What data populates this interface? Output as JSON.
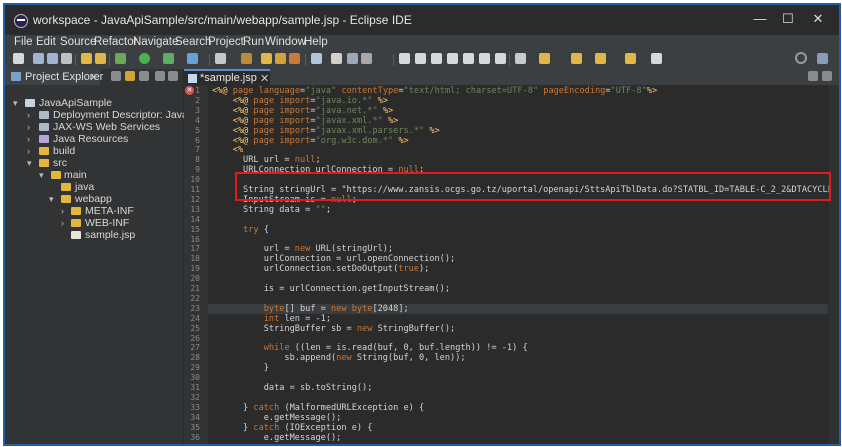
{
  "window": {
    "title": "workspace - JavaApiSample/src/main/webapp/sample.jsp - Eclipse IDE",
    "minimize": "—",
    "maximize": "☐",
    "close": "✕"
  },
  "menu": [
    "File",
    "Edit",
    "Source",
    "Refactor",
    "Navigate",
    "Search",
    "Project",
    "Run",
    "Window",
    "Help"
  ],
  "project_explorer": {
    "tab_label": "Project Explorer",
    "tree": [
      {
        "label": "JavaApiSample",
        "depth": 0,
        "expanded": true,
        "icon": "project-icon"
      },
      {
        "label": "Deployment Descriptor: JavaApiSam",
        "depth": 1,
        "expanded": false,
        "icon": "descriptor-icon"
      },
      {
        "label": "JAX-WS Web Services",
        "depth": 1,
        "expanded": false,
        "icon": "webservice-icon"
      },
      {
        "label": "Java Resources",
        "depth": 1,
        "expanded": false,
        "icon": "library-icon"
      },
      {
        "label": "build",
        "depth": 1,
        "expanded": false,
        "icon": "folder-icon"
      },
      {
        "label": "src",
        "depth": 1,
        "expanded": true,
        "icon": "folder-icon"
      },
      {
        "label": "main",
        "depth": 2,
        "expanded": true,
        "icon": "folder-icon"
      },
      {
        "label": "java",
        "depth": 3,
        "expanded": null,
        "icon": "folder-icon"
      },
      {
        "label": "webapp",
        "depth": 3,
        "expanded": true,
        "icon": "folder-icon"
      },
      {
        "label": "META-INF",
        "depth": 4,
        "expanded": false,
        "icon": "folder-icon"
      },
      {
        "label": "WEB-INF",
        "depth": 4,
        "expanded": false,
        "icon": "folder-icon"
      },
      {
        "label": "sample.jsp",
        "depth": 4,
        "expanded": null,
        "icon": "jsp-file-icon"
      }
    ]
  },
  "editor": {
    "tab_label": "*sample.jsp",
    "highlighted_line": 23,
    "lines": [
      {
        "n": "1",
        "text": "<%@ page language=\"java\" contentType=\"text/html; charset=UTF-8\" pageEncoding=\"UTF-8\"%>"
      },
      {
        "n": "2",
        "text": "    <%@ page import=\"java.io.*\" %>"
      },
      {
        "n": "3",
        "text": "    <%@ page import=\"java.net.*\" %>"
      },
      {
        "n": "4",
        "text": "    <%@ page import=\"javax.xml.*\" %>"
      },
      {
        "n": "5",
        "text": "    <%@ page import=\"javax.xml.parsers.*\" %>"
      },
      {
        "n": "6",
        "text": "    <%@ page import=\"org.w3c.dom.*\" %>"
      },
      {
        "n": "7",
        "text": "    <%"
      },
      {
        "n": "8",
        "text": "      URL url = null;"
      },
      {
        "n": "9",
        "text": "      URLConnection urlConnection = null;"
      },
      {
        "n": "10",
        "text": ""
      },
      {
        "n": "11",
        "text": "      String stringUrl = \"https://www.zansis.ocgs.go.tz/uportal/openapi/SttsApiTblData.do?STATBL_ID=TABLE-C_2_2&DTACYCLE_CD=YY&WRTTIM"
      },
      {
        "n": "12",
        "text": "      InputStream is = null;"
      },
      {
        "n": "13",
        "text": "      String data = \"\";"
      },
      {
        "n": "14",
        "text": ""
      },
      {
        "n": "15",
        "text": "      try {"
      },
      {
        "n": "16",
        "text": ""
      },
      {
        "n": "17",
        "text": "          url = new URL(stringUrl);"
      },
      {
        "n": "18",
        "text": "          urlConnection = url.openConnection();"
      },
      {
        "n": "19",
        "text": "          urlConnection.setDoOutput(true);"
      },
      {
        "n": "20",
        "text": ""
      },
      {
        "n": "21",
        "text": "          is = urlConnection.getInputStream();"
      },
      {
        "n": "22",
        "text": ""
      },
      {
        "n": "23",
        "text": "          byte[] buf = new byte[2048];"
      },
      {
        "n": "24",
        "text": "          int len = -1;"
      },
      {
        "n": "25",
        "text": "          StringBuffer sb = new StringBuffer();"
      },
      {
        "n": "26",
        "text": ""
      },
      {
        "n": "27",
        "text": "          while ((len = is.read(buf, 0, buf.length)) != -1) {"
      },
      {
        "n": "28",
        "text": "              sb.append(new String(buf, 0, len));"
      },
      {
        "n": "29",
        "text": "          }"
      },
      {
        "n": "30",
        "text": ""
      },
      {
        "n": "31",
        "text": "          data = sb.toString();"
      },
      {
        "n": "32",
        "text": ""
      },
      {
        "n": "33",
        "text": "      } catch (MalformedURLException e) {"
      },
      {
        "n": "34",
        "text": "          e.getMessage();"
      },
      {
        "n": "35",
        "text": "      } catch (IOException e) {"
      },
      {
        "n": "36",
        "text": "          e.getMessage();"
      }
    ]
  },
  "colors": {
    "keyword": "#cc7832",
    "string": "#6a8759",
    "directive": "#ffc66d",
    "annotation_box": "#e41a1a",
    "tab_accent": "#5a8dc8"
  }
}
